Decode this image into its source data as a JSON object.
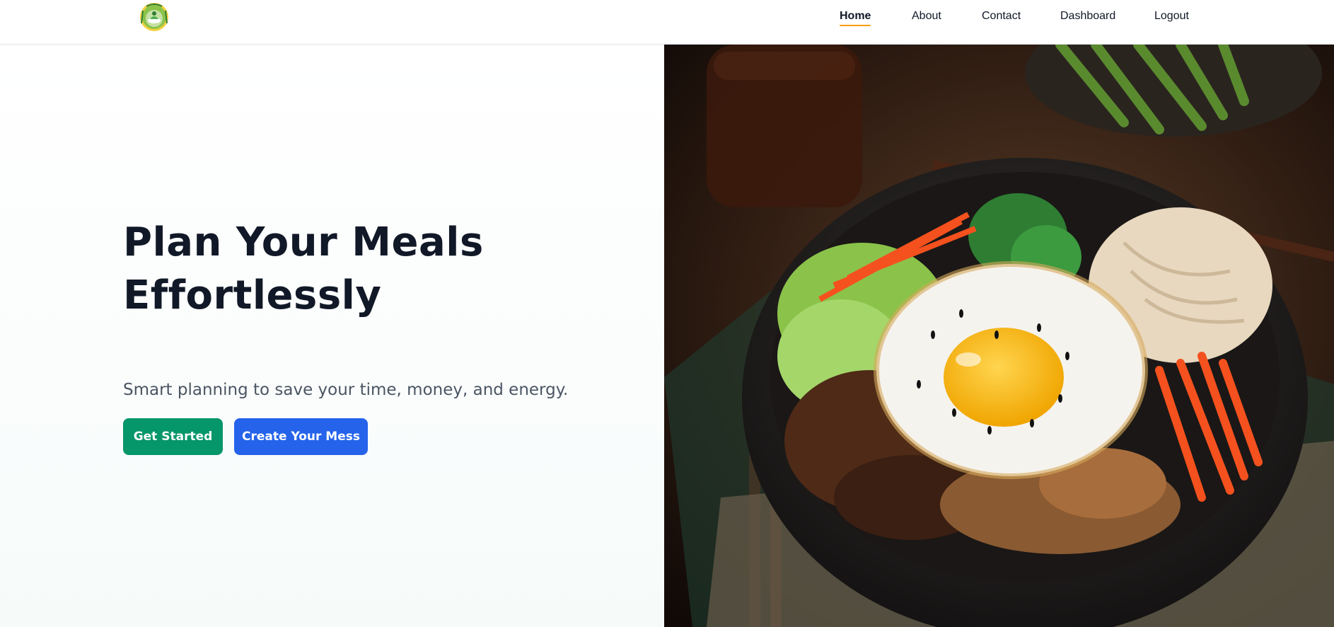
{
  "header": {
    "logo_icon": "meal-planner-logo",
    "nav": [
      {
        "label": "Home",
        "active": true
      },
      {
        "label": "About",
        "active": false
      },
      {
        "label": "Contact",
        "active": false
      },
      {
        "label": "Dashboard",
        "active": false
      },
      {
        "label": "Logout",
        "active": false
      }
    ],
    "active_underline_color": "#f59e0b"
  },
  "hero": {
    "title_line1": "Plan Your Meals",
    "title_line2": "Effortlessly",
    "subtitle": "Smart planning to save your time, money, and energy.",
    "primary_button": {
      "label": "Get Started",
      "color": "#059669"
    },
    "secondary_button": {
      "label": "Create Your Mess",
      "color": "#2563eb"
    },
    "image_icon": "bibimbap-bowl-photo"
  }
}
